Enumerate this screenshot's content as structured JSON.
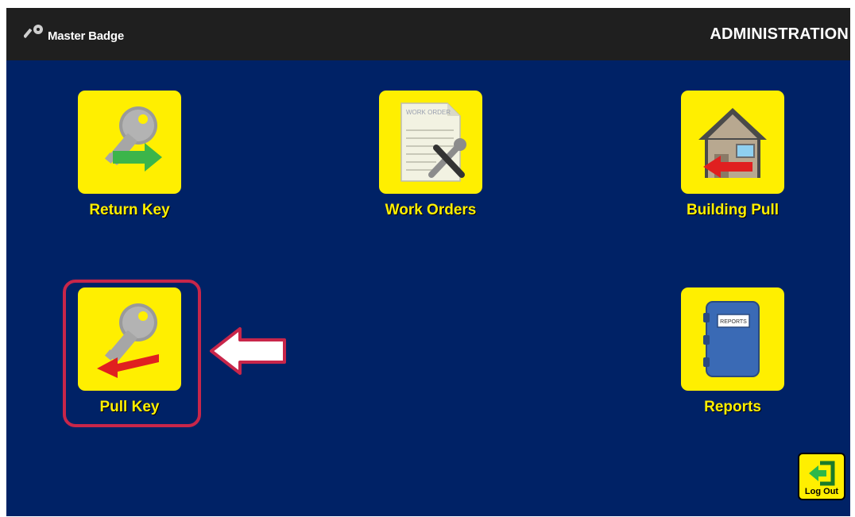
{
  "topbar": {
    "brand_icon": "key-icon",
    "brand_text": "Master Badge",
    "section_title": "ADMINISTRATION"
  },
  "tiles": [
    {
      "label": "Return Key",
      "icon": "return-key-icon"
    },
    {
      "label": "Work Orders",
      "icon": "work-orders-icon",
      "doc_text": "WORK ORDER"
    },
    {
      "label": "Building Pull",
      "icon": "building-pull-icon"
    },
    {
      "label": "Pull Key",
      "icon": "pull-key-icon"
    },
    {
      "label": "Reports",
      "icon": "reports-icon",
      "book_text": "REPORTS"
    }
  ],
  "logout": {
    "label": "Log Out",
    "icon": "logout-icon"
  },
  "colors": {
    "background": "#002266",
    "topbar": "#1f1f1f",
    "tile": "#ffef00",
    "label": "#ffef00",
    "highlight": "#c8264a",
    "arrow_green": "#3cb54a",
    "arrow_red": "#e02020"
  }
}
